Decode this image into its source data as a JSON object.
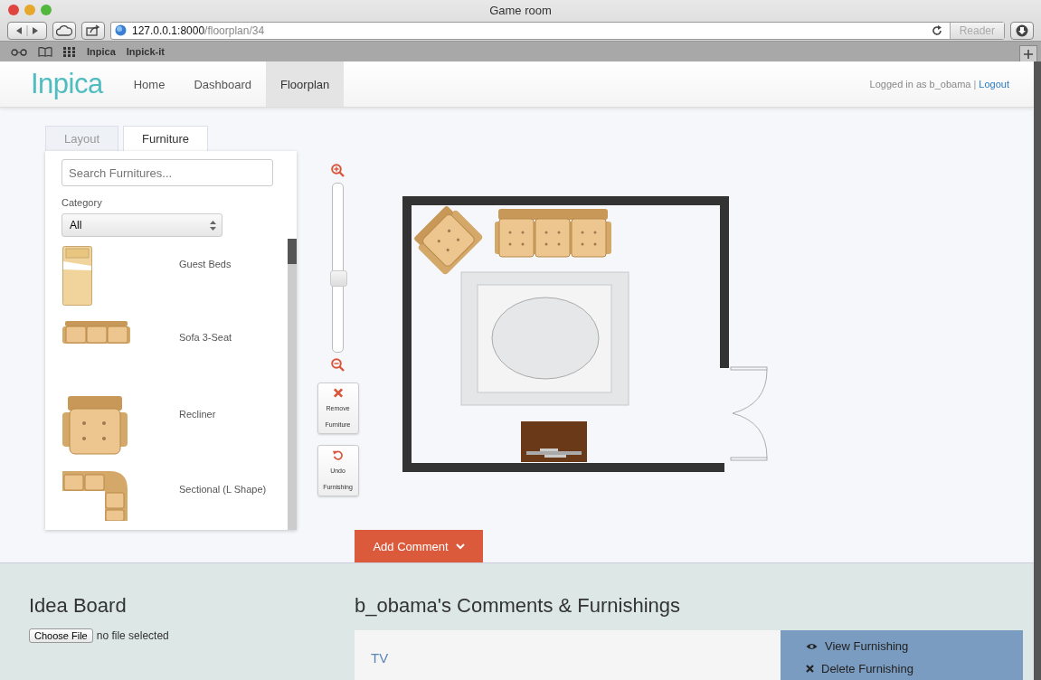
{
  "browser": {
    "title": "Game room",
    "url_host": "127.0.0.1:8000",
    "url_path": "/floorplan/34",
    "reader_button": "Reader",
    "bookmarks": [
      "Inpica",
      "Inpick-it"
    ]
  },
  "nav": {
    "logo": "Inpica",
    "items": [
      {
        "label": "Home",
        "selected": false
      },
      {
        "label": "Dashboard",
        "selected": false
      },
      {
        "label": "Floorplan",
        "selected": true
      }
    ],
    "login_text": "Logged in as b_obama",
    "separator": "|",
    "logout_link": "Logout"
  },
  "tabs": [
    {
      "label": "Layout",
      "selected": false
    },
    {
      "label": "Furniture",
      "selected": true
    }
  ],
  "search": {
    "placeholder": "Search Furnitures..."
  },
  "category": {
    "label": "Category",
    "value": "All"
  },
  "furniture_items": [
    {
      "name": "Guest Beds",
      "kind": "bed"
    },
    {
      "name": "Sofa 3-Seat",
      "kind": "sofa"
    },
    {
      "name": "Recliner",
      "kind": "recliner"
    },
    {
      "name": "Sectional (L Shape)",
      "kind": "sectional"
    }
  ],
  "zoom": {
    "level": 0.43
  },
  "tool_buttons": [
    {
      "label": "Remove Furniture",
      "kind": "remove"
    },
    {
      "label": "Undo Furnishing",
      "kind": "undo"
    }
  ],
  "add_comment": {
    "label": "Add Comment"
  },
  "idea_board": {
    "title": "Idea Board",
    "file_button": "Choose File",
    "file_status": "no file selected"
  },
  "comments": {
    "title": "b_obama's Comments & Furnishings",
    "item_title": "TV",
    "actions": [
      {
        "label": "View Furnishing",
        "kind": "view"
      },
      {
        "label": "Delete Furnishing",
        "kind": "delete"
      }
    ]
  }
}
